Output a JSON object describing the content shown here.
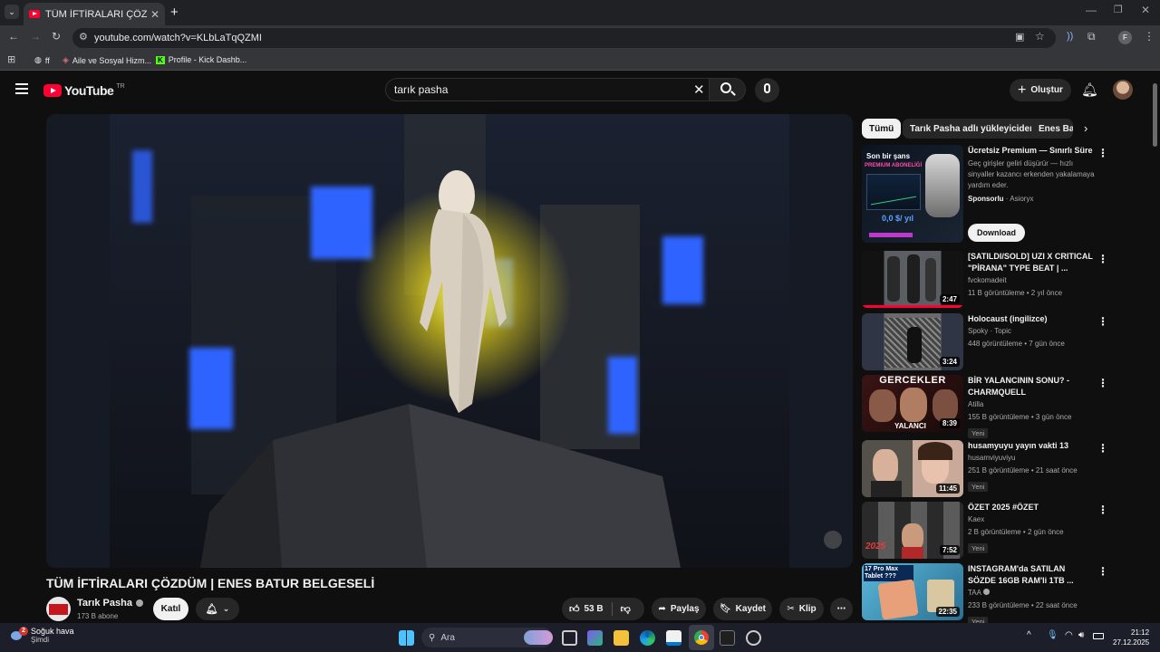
{
  "browser": {
    "tab_title": "TÜM İFTİRALARI ÇÖZDÜM | ENE",
    "url": "youtube.com/watch?v=KLbLaTqQZMI",
    "bookmarks": [
      "ff",
      "Aile ve Sosyal Hizm...",
      "Profile - Kick Dashb..."
    ],
    "profile_letter": "F"
  },
  "header": {
    "logo": "YouTube",
    "region": "TR",
    "search_value": "tarık pasha",
    "create_label": "Oluştur"
  },
  "video": {
    "title": "TÜM İFTİRALARI ÇÖZDÜM | ENES BATUR BELGESELİ",
    "channel": "Tarık Pasha",
    "subscribers": "173 B abone",
    "join_label": "Katıl",
    "likes": "53 B",
    "share_label": "Paylaş",
    "save_label": "Kaydet",
    "clip_label": "Klip"
  },
  "chips": [
    "Tümü",
    "Tarık Pasha adlı yükleyiciden",
    "Enes Bat"
  ],
  "ad": {
    "title": "Ücretsiz Premium — Sınırlı Süre",
    "desc": "Geç girişler geliri düşürür — hızlı sinyaller kazancı erkenden yakalamaya yardım eder.",
    "sponsor": "Sponsorlu",
    "advertiser": "Asioryx",
    "cta": "Download",
    "thumb_line1": "Son bir şans",
    "thumb_line2": "PREMIUM ABONELİĞİ",
    "thumb_price": "0,0 $/ yıl"
  },
  "recommendations": [
    {
      "title": "[SATILDI/SOLD] UZI X CRITICAL \"PİRANA\" TYPE BEAT | ...",
      "channel": "fvckomadeit",
      "stats": "11 B görüntüleme • 2 yıl önce",
      "duration": "2:47",
      "new": ""
    },
    {
      "title": "Holocaust (ingilizce)",
      "channel": "Spoky · Topic",
      "stats": "448 görüntüleme • 7 gün önce",
      "duration": "3:24",
      "new": ""
    },
    {
      "title": "BİR YALANCININ SONU? - CHARMQUELL",
      "channel": "Atilla",
      "stats": "155 B görüntüleme • 3 gün önce",
      "duration": "8:39",
      "new": "Yeni"
    },
    {
      "title": "husamyuyu yayın vakti 13",
      "channel": "husamviyuviyu",
      "stats": "251 B görüntüleme • 21 saat önce",
      "duration": "11:45",
      "new": "Yeni"
    },
    {
      "title": "ÖZET 2025 #ÖZET",
      "channel": "Kaex",
      "stats": "2 B görüntüleme • 2 gün önce",
      "duration": "7:52",
      "new": "Yeni"
    },
    {
      "title": "INSTAGRAM'da SATILAN SÖZDE 16GB RAM'li 1TB ...",
      "channel": "TAA",
      "stats": "233 B görüntüleme • 22 saat önce",
      "duration": "22:35",
      "new": "Yeni"
    }
  ],
  "thumb_texts": {
    "gercekler": "GERCEKLER",
    "yalanci": "YALANCI",
    "tablet": "17 Pro Max Tablet ???",
    "year": "2025"
  },
  "taskbar": {
    "weather_title": "Soğuk hava",
    "weather_sub": "Şimdi",
    "weather_temp": "2",
    "search_placeholder": "Ara",
    "time": "21:12",
    "date": "27.12.2025"
  }
}
